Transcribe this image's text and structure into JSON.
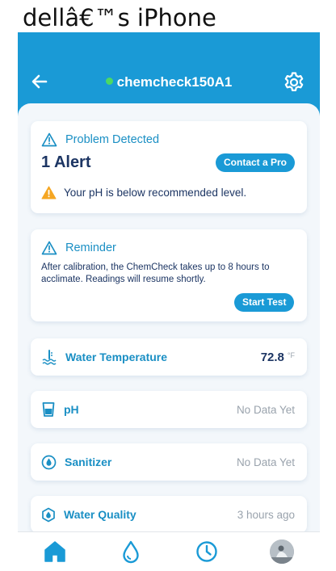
{
  "window": {
    "title": "dellâ€™s iPhone"
  },
  "header": {
    "device_name": "chemcheck150A1"
  },
  "alert_card": {
    "heading": "Problem Detected",
    "count_text": "1 Alert",
    "action_label": "Contact a Pro",
    "message": "Your pH is below recommended level."
  },
  "reminder_card": {
    "heading": "Reminder",
    "body": "After calibration, the ChemCheck takes up to 8 hours to acclimate. Readings will resume shortly.",
    "action_label": "Start Test"
  },
  "readings": {
    "water_temperature": {
      "label": "Water Temperature",
      "value": "72.8",
      "unit": "°F"
    },
    "ph": {
      "label": "pH",
      "value": "No Data Yet"
    },
    "sanitizer": {
      "label": "Sanitizer",
      "value": "No Data Yet"
    },
    "water_quality": {
      "label": "Water Quality",
      "value": "3 hours ago"
    }
  },
  "tabs": {
    "items": [
      "home-icon",
      "water-drop-icon",
      "clock-icon",
      "profile-avatar"
    ],
    "active": "home-icon"
  },
  "colors": {
    "brand": "#1a9ad6",
    "navy": "#1c3563",
    "accent_text": "#1a8fc4",
    "warning": "#f5a623",
    "online": "#4cd964",
    "muted": "#9aa3ad"
  }
}
